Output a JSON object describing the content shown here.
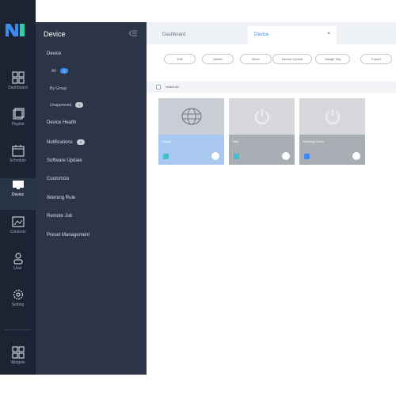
{
  "rail": {
    "items": [
      {
        "label": "Dashboard",
        "icon": "dashboard-icon"
      },
      {
        "label": "Playlist",
        "icon": "playlist-icon"
      },
      {
        "label": "Schedule",
        "icon": "schedule-icon"
      },
      {
        "label": "Device",
        "icon": "device-icon"
      },
      {
        "label": "Contents",
        "icon": "contents-icon"
      },
      {
        "label": "User",
        "icon": "user-icon"
      },
      {
        "label": "Setting",
        "icon": "setting-icon"
      },
      {
        "label": "Widgets",
        "icon": "widgets-icon"
      }
    ]
  },
  "submenu": {
    "title": "Device",
    "section": "Device",
    "all_label": "All",
    "all_count": "3",
    "by_group": "By Group",
    "unapproved": "Unapproved",
    "unapproved_count": "0",
    "items": [
      "Device Health",
      "Notifications",
      "Software Update",
      "Customize",
      "Warning Rule",
      "Remote Job",
      "Preset Management"
    ],
    "notifications_count": "0"
  },
  "tabs": [
    {
      "label": "Dashboard"
    },
    {
      "label": "Device",
      "close": "×"
    }
  ],
  "chips": [
    "Edit",
    "Delete",
    "Move",
    "Device Control",
    "Assign Tag",
    "Export"
  ],
  "select_all": "Select All",
  "cards": [
    {
      "name": "Lobby",
      "badge_color": "#3fc1c9"
    },
    {
      "name": "Hall",
      "badge_color": "#3fc1c9"
    },
    {
      "name": "Meeting Room",
      "badge_color": "#3b8ced"
    }
  ],
  "colors": {
    "accent": "#3b8ced",
    "rail_bg": "#1c2433",
    "submenu_bg": "#2c3547"
  }
}
